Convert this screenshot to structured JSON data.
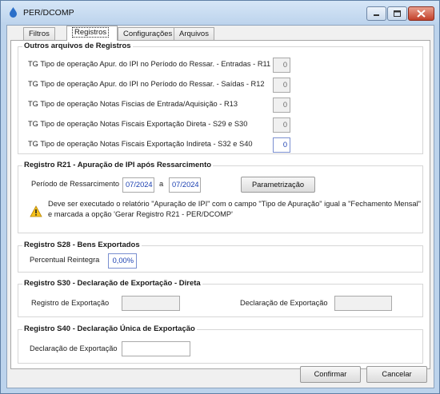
{
  "window": {
    "title": "PER/DCOMP"
  },
  "tabs": [
    {
      "label": "Filtros"
    },
    {
      "label": "Registros"
    },
    {
      "label": "Configurações"
    },
    {
      "label": "Arquivos"
    }
  ],
  "outros": {
    "title": "Outros arquivos de Registros",
    "rows": [
      {
        "label": "TG Tipo de operação Apur. do IPI no Período do Ressar. - Entradas - R11",
        "value": "0"
      },
      {
        "label": "TG Tipo de operação Apur. do IPI no Período do Ressar. - Saídas - R12",
        "value": "0"
      },
      {
        "label": "TG Tipo de operação Notas Fiscias de Entrada/Aquisição - R13",
        "value": "0"
      },
      {
        "label": "TG Tipo de operação Notas Fiscais Exportação Direta - S29 e S30",
        "value": "0"
      },
      {
        "label": "TG Tipo de operação Notas Fiscais Exportação Indireta - S32 e S40",
        "value": "0"
      }
    ]
  },
  "r21": {
    "title": "Registro R21 - Apuração de IPI após Ressarcimento",
    "periodo_label": "Período de Ressarcimento",
    "periodo_from": "07/2024",
    "a_label": "a",
    "periodo_to": "07/2024",
    "param_button": "Parametrização",
    "warning_line1": "Deve ser executado o relatório \"Apuração de IPI\" com o campo \"Tipo de Apuração\" igual a \"Fechamento Mensal\"",
    "warning_line2": "e marcada a opção 'Gerar Registro R21 - PER/DCOMP'"
  },
  "s28": {
    "title": "Registro S28 - Bens Exportados",
    "percentual_label": "Percentual Reintegra",
    "percentual_value": "0,00%"
  },
  "s30": {
    "title": "Registro S30 - Declaração de Exportação - Direta",
    "registro_label": "Registro de Exportação",
    "registro_value": "",
    "declaracao_label": "Declaração de Exportação",
    "declaracao_value": ""
  },
  "s40": {
    "title": "Registro S40 - Declaração Única de Exportação",
    "declaracao_label": "Declaração de Exportação",
    "declaracao_value": ""
  },
  "footer": {
    "confirm_label": "Confirmar",
    "cancel_label": "Cancelar"
  },
  "colors": {
    "accent": "#1a3fb0",
    "close": "#c2402a"
  }
}
